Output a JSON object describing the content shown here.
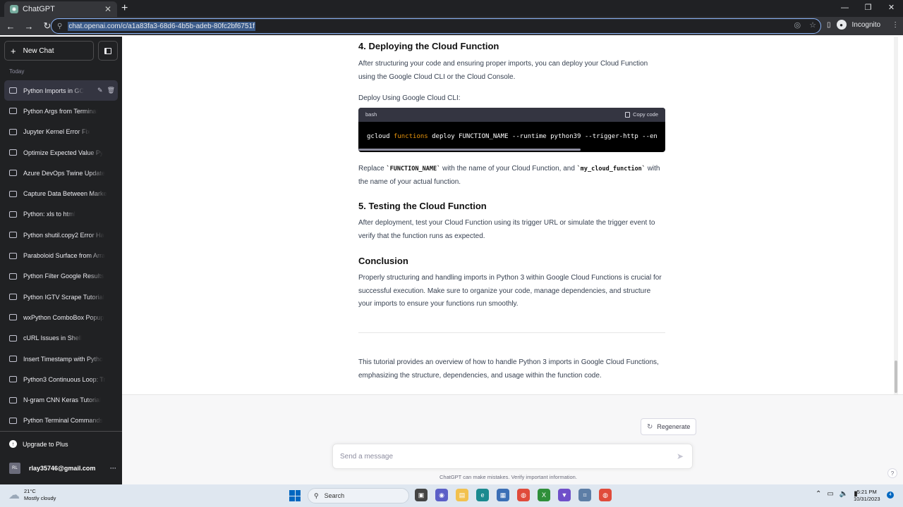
{
  "browser": {
    "tab_title": "ChatGPT",
    "url": "chat.openai.com/c/a1a83fa3-68d6-4b5b-adeb-80fc2bf6751f",
    "profile_label": "Incognito"
  },
  "sidebar": {
    "new_chat_label": "New Chat",
    "section_label": "Today",
    "chats": [
      "Python Imports in GC",
      "Python Args from Terminal",
      "Jupyter Kernel Error Fix",
      "Optimize Expected Value Py",
      "Azure DevOps Twine Update",
      "Capture Data Between Marke",
      "Python: xls to html",
      "Python shutil.copy2 Error Ha",
      "Paraboloid Surface from Arra",
      "Python Filter Google Results",
      "Python IGTV Scrape Tutorial",
      "wxPython ComboBox Popup",
      "cURL Issues in Shell",
      "Insert Timestamp with Pytho",
      "Python3 Continuous Loop: Tr",
      "N-gram CNN Keras Tutorial",
      "Python Terminal Commands"
    ],
    "upgrade_label": "Upgrade to Plus",
    "user_initials": "RL",
    "user_email": "rlay35746@gmail.com"
  },
  "content": {
    "h_deploy": "4. Deploying the Cloud Function",
    "p_deploy": "After structuring your code and ensuring proper imports, you can deploy your Cloud Function using the Google Cloud CLI or the Cloud Console.",
    "deploy_cli_label": "Deploy Using Google Cloud CLI:",
    "code": {
      "lang": "bash",
      "copy_label": "Copy code",
      "cmd": "gcloud",
      "keyword": "functions",
      "rest": "deploy FUNCTION_NAME --runtime python39 --trigger-http --en"
    },
    "replace": {
      "t1": "Replace ",
      "code1": "`FUNCTION_NAME`",
      "t2": " with the name of your Cloud Function, and ",
      "code2": "`my_cloud_function`",
      "t3": " with the name of your actual function."
    },
    "h_testing": "5. Testing the Cloud Function",
    "p_testing": "After deployment, test your Cloud Function using its trigger URL or simulate the trigger event to verify that the function runs as expected.",
    "h_conclusion": "Conclusion",
    "p_conclusion": "Properly structuring and handling imports in Python 3 within Google Cloud Functions is crucial for successful execution. Make sure to organize your code, manage dependencies, and structure your imports to ensure your functions run smoothly.",
    "p_summary": "This tutorial provides an overview of how to handle Python 3 imports in Google Cloud Functions, emphasizing the structure, dependencies, and usage within the function code."
  },
  "composer": {
    "regenerate_label": "Regenerate",
    "placeholder": "Send a message",
    "disclaimer": "ChatGPT can make mistakes. Verify important information.",
    "help": "?"
  },
  "taskbar": {
    "temperature": "21°C",
    "weather": "Mostly cloudy",
    "search_label": "Search",
    "time": "5:21 PM",
    "date": "10/31/2023",
    "notification_count": "4"
  }
}
